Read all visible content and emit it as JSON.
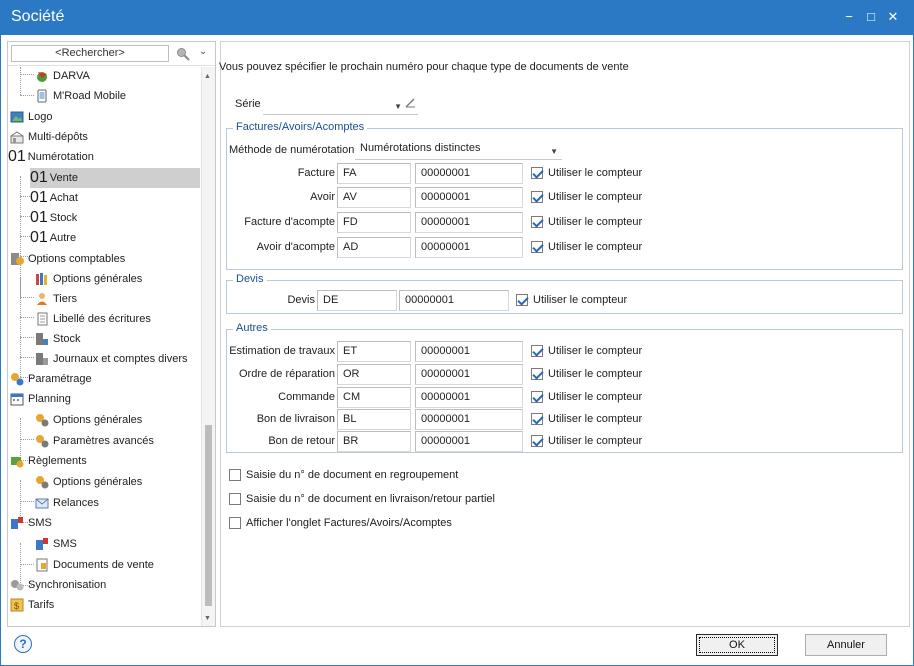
{
  "window": {
    "title": "Société"
  },
  "sidebar": {
    "search_placeholder": "<Rechercher>",
    "items": [
      {
        "label": "DARVA",
        "icon": "darva-icon"
      },
      {
        "label": "M'Road Mobile",
        "icon": "mobile-icon"
      },
      {
        "label": "Logo",
        "icon": "image-icon"
      },
      {
        "label": "Multi-dépôts",
        "icon": "warehouse-icon"
      },
      {
        "label": "Numérotation",
        "icon": "numbering-icon",
        "glyph": "01"
      },
      {
        "label": "Vente",
        "icon": "numbering-icon",
        "glyph": "01"
      },
      {
        "label": "Achat",
        "icon": "numbering-icon",
        "glyph": "01"
      },
      {
        "label": "Stock",
        "icon": "numbering-icon",
        "glyph": "01"
      },
      {
        "label": "Autre",
        "icon": "numbering-icon",
        "glyph": "01"
      },
      {
        "label": "Options comptables",
        "icon": "accounting-icon"
      },
      {
        "label": "Options générales",
        "icon": "books-icon"
      },
      {
        "label": "Tiers",
        "icon": "person-icon"
      },
      {
        "label": "Libellé des écritures",
        "icon": "document-icon"
      },
      {
        "label": "Stock",
        "icon": "stock-icon"
      },
      {
        "label": "Journaux et comptes divers",
        "icon": "journal-icon"
      },
      {
        "label": "Paramétrage",
        "icon": "settings-icon"
      },
      {
        "label": "Planning",
        "icon": "calendar-icon"
      },
      {
        "label": "Options générales",
        "icon": "gears-icon"
      },
      {
        "label": "Paramètres avancés",
        "icon": "gears-icon"
      },
      {
        "label": "Règlements",
        "icon": "payment-icon"
      },
      {
        "label": "Options générales",
        "icon": "gears-icon"
      },
      {
        "label": "Relances",
        "icon": "mail-icon"
      },
      {
        "label": "SMS",
        "icon": "sms-icon"
      },
      {
        "label": "SMS",
        "icon": "sms-icon"
      },
      {
        "label": "Documents de vente",
        "icon": "sales-doc-icon"
      },
      {
        "label": "Synchronisation",
        "icon": "sync-icon"
      },
      {
        "label": "Tarifs",
        "icon": "price-icon"
      }
    ]
  },
  "main": {
    "intro": "Vous pouvez spécifier le prochain numéro pour chaque type de documents de vente",
    "serie_label": "Série",
    "factures_group": {
      "title": "Factures/Avoirs/Acomptes",
      "method_label": "Méthode de numérotation",
      "method_value": "Numérotations distinctes",
      "rows": [
        {
          "label": "Facture",
          "prefix": "FA",
          "number": "00000001",
          "use_label": "Utiliser le compteur",
          "checked": true
        },
        {
          "label": "Avoir",
          "prefix": "AV",
          "number": "00000001",
          "use_label": "Utiliser le compteur",
          "checked": true
        },
        {
          "label": "Facture d'acompte",
          "prefix": "FD",
          "number": "00000001",
          "use_label": "Utiliser le compteur",
          "checked": true
        },
        {
          "label": "Avoir d'acompte",
          "prefix": "AD",
          "number": "00000001",
          "use_label": "Utiliser le compteur",
          "checked": true
        }
      ]
    },
    "devis_group": {
      "title": "Devis",
      "rows": [
        {
          "label": "Devis",
          "prefix": "DE",
          "number": "00000001",
          "use_label": "Utiliser le compteur",
          "checked": true
        }
      ]
    },
    "autres_group": {
      "title": "Autres",
      "rows": [
        {
          "label": "Estimation de travaux",
          "prefix": "ET",
          "number": "00000001",
          "use_label": "Utiliser le compteur",
          "checked": true
        },
        {
          "label": "Ordre de réparation",
          "prefix": "OR",
          "number": "00000001",
          "use_label": "Utiliser le compteur",
          "checked": true
        },
        {
          "label": "Commande",
          "prefix": "CM",
          "number": "00000001",
          "use_label": "Utiliser le compteur",
          "checked": true
        },
        {
          "label": "Bon de livraison",
          "prefix": "BL",
          "number": "00000001",
          "use_label": "Utiliser le compteur",
          "checked": true
        },
        {
          "label": "Bon de retour",
          "prefix": "BR",
          "number": "00000001",
          "use_label": "Utiliser le compteur",
          "checked": true
        }
      ]
    },
    "options": [
      {
        "label": "Saisie du n° de document en regroupement",
        "checked": false
      },
      {
        "label": "Saisie du n° de document en livraison/retour partiel",
        "checked": false
      },
      {
        "label": "Afficher l'onglet Factures/Avoirs/Acomptes",
        "checked": false
      }
    ]
  },
  "footer": {
    "ok_label": "OK",
    "cancel_label": "Annuler"
  }
}
